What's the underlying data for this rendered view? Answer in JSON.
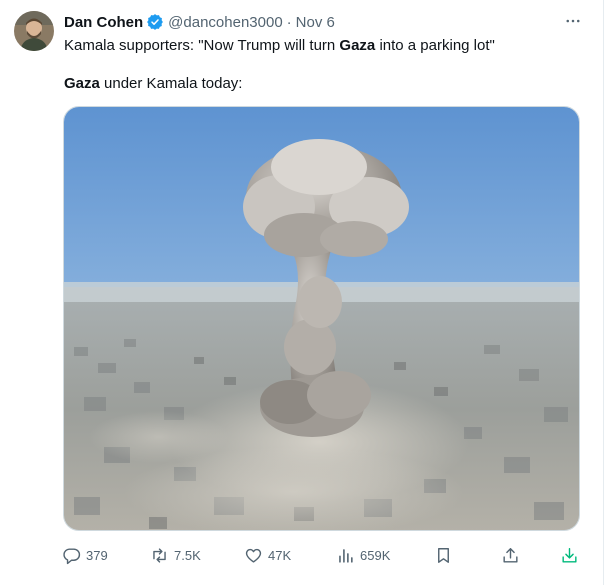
{
  "author": {
    "name": "Dan Cohen",
    "handle": "@dancohen3000",
    "separator": "·",
    "date": "Nov 6",
    "verified": true
  },
  "tweet": {
    "line1_pre": "Kamala supporters: \"Now Trump will turn ",
    "line1_bold": "Gaza",
    "line1_post": " into a parking lot\"",
    "line2_bold": "Gaza",
    "line2_post": " under Kamala today:"
  },
  "actions": {
    "replies": "379",
    "reposts": "7.5K",
    "likes": "47K",
    "views": "659K"
  },
  "colors": {
    "verified": "#1d9bf0",
    "muted": "#536471",
    "download": "#00ba7c"
  },
  "icons": [
    "more-icon",
    "verified-icon",
    "reply-icon",
    "repost-icon",
    "like-icon",
    "views-icon",
    "bookmark-icon",
    "share-icon",
    "download-icon"
  ]
}
